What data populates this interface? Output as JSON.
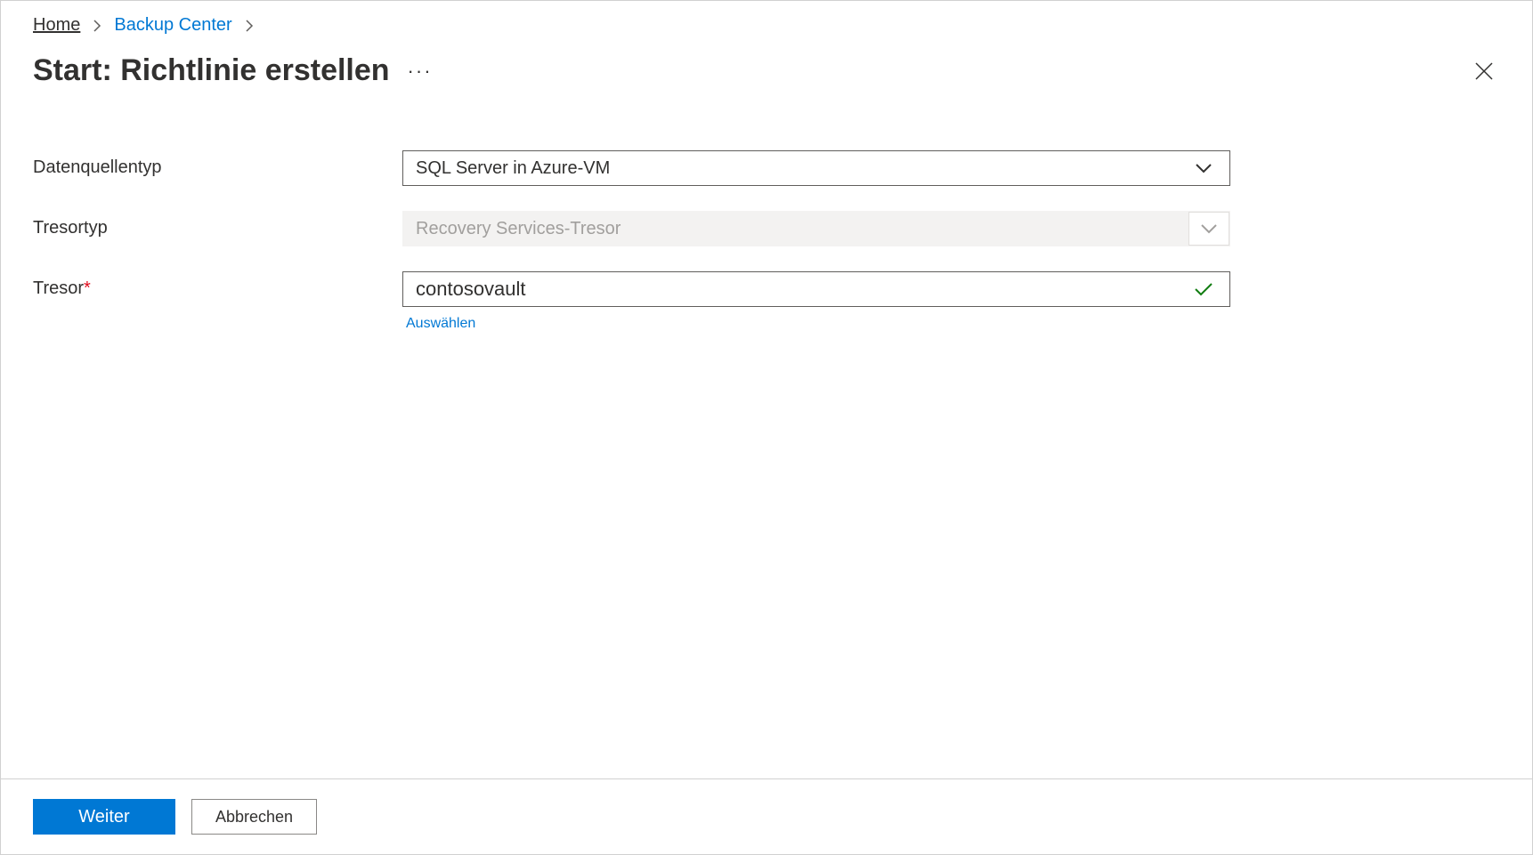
{
  "breadcrumb": {
    "home": "Home",
    "backup_center": "Backup Center"
  },
  "header": {
    "title": "Start: Richtlinie erstellen"
  },
  "form": {
    "datasource_type": {
      "label": "Datenquellentyp",
      "value": "SQL Server in Azure-VM"
    },
    "vault_type": {
      "label": "Tresortyp",
      "value": "Recovery Services-Tresor"
    },
    "vault": {
      "label": "Tresor",
      "value": "contosovault",
      "helper": "Auswählen"
    }
  },
  "footer": {
    "continue": "Weiter",
    "cancel": "Abbrechen"
  }
}
